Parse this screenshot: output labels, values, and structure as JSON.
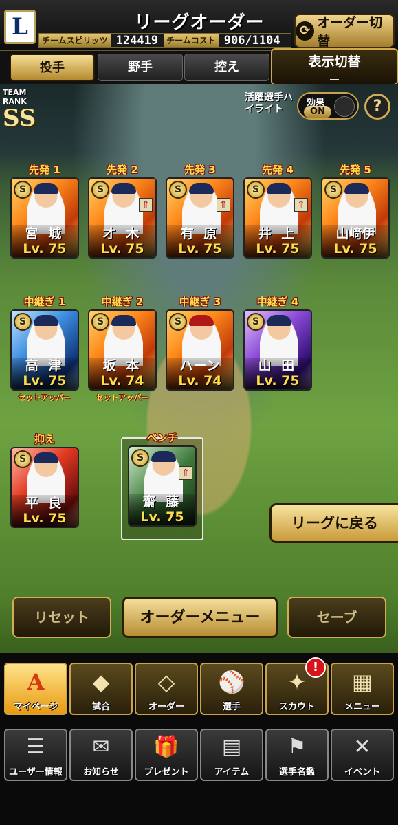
{
  "header": {
    "title": "リーグオーダー",
    "team_spirit_label": "チームスピリッツ",
    "team_spirit_value": "124419",
    "team_cost_label": "チームコスト",
    "team_cost_value": "906/1104",
    "order_switch_label": "オーダー切替",
    "team_logo_letter": "L"
  },
  "tabs": {
    "pitcher": "投手",
    "fielder": "野手",
    "reserve": "控え"
  },
  "display_toggle": {
    "label": "表示切替",
    "value": "ー"
  },
  "team_rank": {
    "label": "TEAM RANK",
    "value": "SS"
  },
  "highlight": {
    "label": "活躍選手ハイライト",
    "effect_label": "効果",
    "effect_value": "ON",
    "help": "?"
  },
  "slots": [
    {
      "role": "先発 1",
      "name": "宮 城",
      "level": "Lv. 75",
      "badge": "S"
    },
    {
      "role": "先発 2",
      "name": "才 木",
      "level": "Lv. 75",
      "badge": "S"
    },
    {
      "role": "先発 3",
      "name": "有 原",
      "level": "Lv. 75",
      "badge": "S"
    },
    {
      "role": "先発 4",
      "name": "井 上",
      "level": "Lv. 75",
      "badge": "S"
    },
    {
      "role": "先発 5",
      "name": "山﨑伊",
      "level": "Lv. 75",
      "badge": "S"
    },
    {
      "role": "中継ぎ 1",
      "name": "高 津",
      "level": "Lv. 75",
      "badge": "S",
      "sub": "セットアッパー"
    },
    {
      "role": "中継ぎ 2",
      "name": "坂 本",
      "level": "Lv. 74",
      "badge": "S",
      "sub": "セットアッパー"
    },
    {
      "role": "中継ぎ 3",
      "name": "ハーン",
      "level": "Lv. 74",
      "badge": "S"
    },
    {
      "role": "中継ぎ 4",
      "name": "山 田",
      "level": "Lv. 75",
      "badge": "S"
    },
    {
      "role": "抑え",
      "name": "平 良",
      "level": "Lv. 75",
      "badge": "S"
    },
    {
      "role": "ベンチ",
      "name": "齋 藤",
      "level": "Lv. 75",
      "badge": "S"
    }
  ],
  "back_to_league": "リーグに戻る",
  "actions": {
    "reset": "リセット",
    "order_menu": "オーダーメニュー",
    "save": "セーブ"
  },
  "nav_top": [
    {
      "label": "マイページ",
      "icon": "A"
    },
    {
      "label": "試合",
      "icon": "◆"
    },
    {
      "label": "オーダー",
      "icon": "◇"
    },
    {
      "label": "選手",
      "icon": "⚾"
    },
    {
      "label": "スカウト",
      "icon": "✦"
    },
    {
      "label": "メニュー",
      "icon": "▦"
    }
  ],
  "notification_badge": "!",
  "nav_bottom": [
    {
      "label": "ユーザー情報",
      "icon": "☰"
    },
    {
      "label": "お知らせ",
      "icon": "✉"
    },
    {
      "label": "プレゼント",
      "icon": "🎁"
    },
    {
      "label": "アイテム",
      "icon": "▤"
    },
    {
      "label": "選手名鑑",
      "icon": "⚑"
    },
    {
      "label": "イベント",
      "icon": "✕"
    }
  ]
}
